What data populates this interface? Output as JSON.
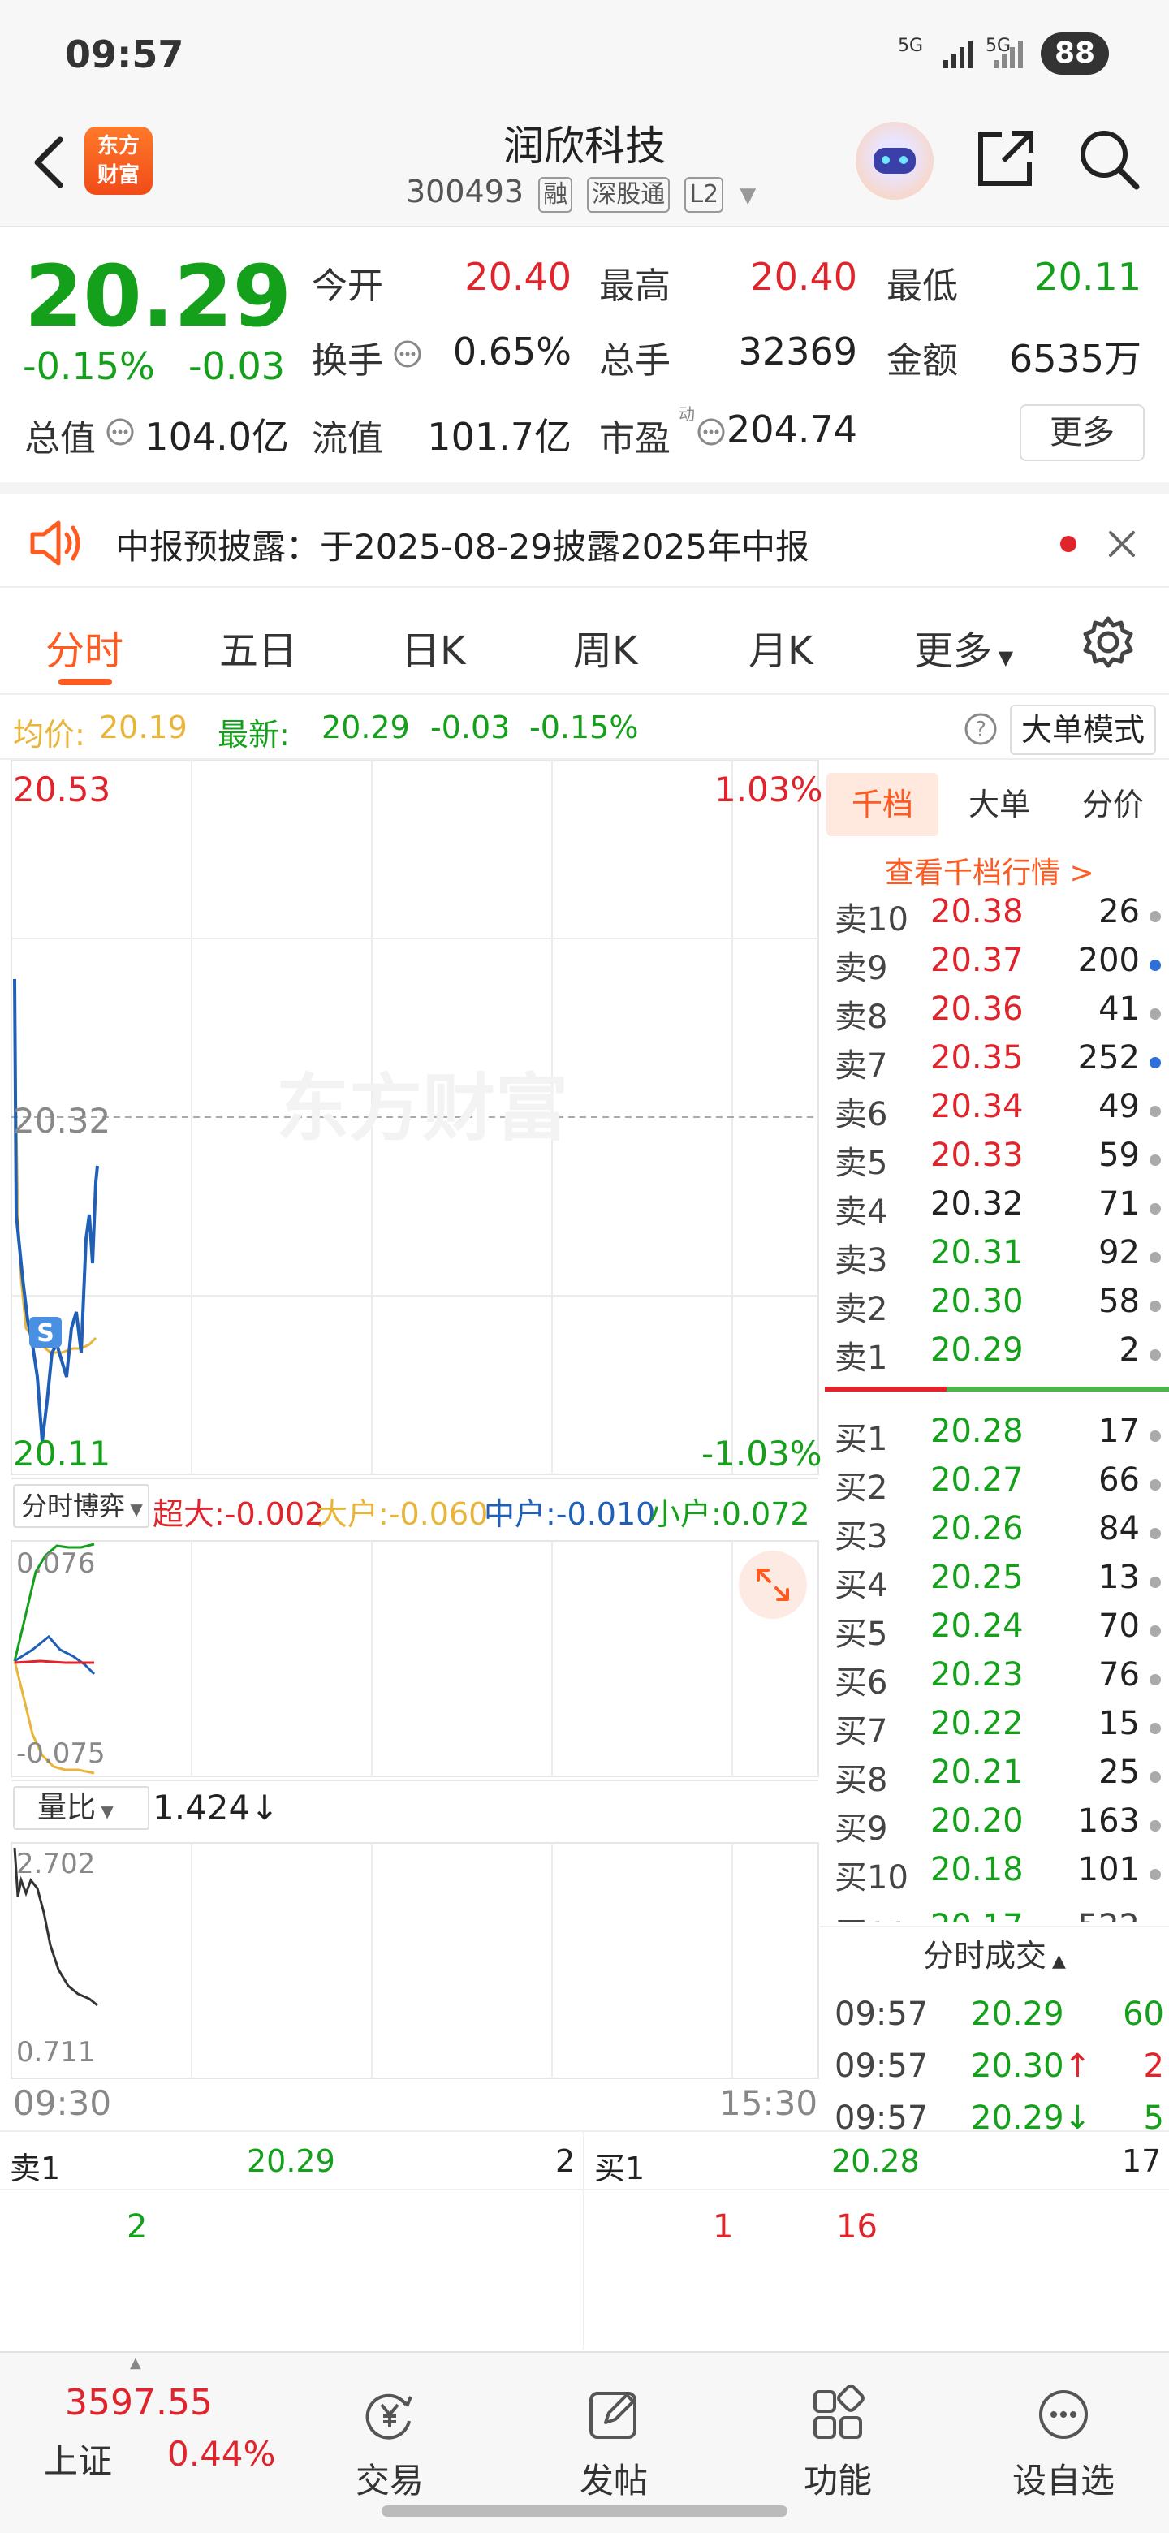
{
  "status_bar": {
    "time": "09:57",
    "signal1": "5G",
    "signal2": "5G",
    "battery": "88"
  },
  "header": {
    "logo_text": "东方财富",
    "stock_name": "润欣科技",
    "stock_code": "300493",
    "tags": [
      "融",
      "深股通",
      "L2"
    ]
  },
  "quote": {
    "price": "20.29",
    "change_pct": "-0.15%",
    "change": "-0.03",
    "open_label": "今开",
    "open": "20.40",
    "high_label": "最高",
    "high": "20.40",
    "low_label": "最低",
    "low": "20.11",
    "turnover_label": "换手",
    "turnover": "0.65%",
    "volume_label": "总手",
    "volume": "32369",
    "amount_label": "金额",
    "amount": "6535万",
    "mktcap_label": "总值",
    "mktcap": "104.0亿",
    "float_label": "流值",
    "float": "101.7亿",
    "pe_label": "市盈",
    "pe_sup": "动",
    "pe": "204.74",
    "more_label": "更多"
  },
  "notice": {
    "text": "中报预披露：于2025-08-29披露2025年中报"
  },
  "tabs": [
    "分时",
    "五日",
    "日K",
    "周K",
    "月K",
    "更多"
  ],
  "info_line": {
    "avg_label": "均价:",
    "avg": "20.19",
    "latest_label": "最新:",
    "latest": "20.29",
    "latest_chg": "-0.03",
    "latest_pct": "-0.15%",
    "mode_button": "大单模式"
  },
  "chart": {
    "y_top": "20.53",
    "y_top_pct": "1.03%",
    "y_mid": "20.32",
    "y_bottom": "20.11",
    "y_bottom_pct": "-1.03%",
    "watermark": "东方财富",
    "marker": "S",
    "flow_selector": "分时博弈",
    "flow_super": "超大:-0.002",
    "flow_large": "大户:-0.060",
    "flow_mid": "中户:-0.010",
    "flow_small": "小户:0.072",
    "flow_top": "0.076",
    "flow_bottom": "-0.075",
    "ratio_selector": "量比",
    "ratio_value": "1.424↓",
    "ratio_top": "2.702",
    "ratio_bottom": "0.711",
    "time_start": "09:30",
    "time_end": "15:30",
    "colors": {
      "price_line": "#1f5fb8",
      "avg_line": "#e8b53a",
      "red": "#e0242b",
      "green": "#14a01a"
    }
  },
  "order_book": {
    "tabs": [
      "千档",
      "大单",
      "分价"
    ],
    "link": "查看千档行情 >",
    "sells": [
      {
        "label": "卖10",
        "price": "20.38",
        "vol": "26",
        "dot": "gray"
      },
      {
        "label": "卖9",
        "price": "20.37",
        "vol": "200",
        "dot": "blue"
      },
      {
        "label": "卖8",
        "price": "20.36",
        "vol": "41",
        "dot": "gray"
      },
      {
        "label": "卖7",
        "price": "20.35",
        "vol": "252",
        "dot": "blue"
      },
      {
        "label": "卖6",
        "price": "20.34",
        "vol": "49",
        "dot": "gray"
      },
      {
        "label": "卖5",
        "price": "20.33",
        "vol": "59",
        "dot": "gray"
      },
      {
        "label": "卖4",
        "price": "20.32",
        "vol": "71",
        "dot": "gray"
      },
      {
        "label": "卖3",
        "price": "20.31",
        "vol": "92",
        "dot": "gray"
      },
      {
        "label": "卖2",
        "price": "20.30",
        "vol": "58",
        "dot": "gray"
      },
      {
        "label": "卖1",
        "price": "20.29",
        "vol": "2",
        "dot": "gray"
      }
    ],
    "buys": [
      {
        "label": "买1",
        "price": "20.28",
        "vol": "17",
        "dot": "gray"
      },
      {
        "label": "买2",
        "price": "20.27",
        "vol": "66",
        "dot": "gray"
      },
      {
        "label": "买3",
        "price": "20.26",
        "vol": "84",
        "dot": "gray"
      },
      {
        "label": "买4",
        "price": "20.25",
        "vol": "13",
        "dot": "gray"
      },
      {
        "label": "买5",
        "price": "20.24",
        "vol": "70",
        "dot": "gray"
      },
      {
        "label": "买6",
        "price": "20.23",
        "vol": "76",
        "dot": "gray"
      },
      {
        "label": "买7",
        "price": "20.22",
        "vol": "15",
        "dot": "gray"
      },
      {
        "label": "买8",
        "price": "20.21",
        "vol": "25",
        "dot": "gray"
      },
      {
        "label": "买9",
        "price": "20.20",
        "vol": "163",
        "dot": "gray"
      },
      {
        "label": "买10",
        "price": "20.18",
        "vol": "101",
        "dot": "gray"
      }
    ],
    "ticks_title": "分时成交",
    "ticks": [
      {
        "time": "09:57",
        "price": "20.29",
        "vol": "60",
        "dir": ""
      },
      {
        "time": "09:57",
        "price": "20.30↑",
        "vol": "2",
        "dir": "up"
      },
      {
        "time": "09:57",
        "price": "20.29↓",
        "vol": "5",
        "dir": "down"
      }
    ]
  },
  "queue": {
    "sell_label": "卖1",
    "sell_price": "20.29",
    "sell_vol": "2",
    "buy_label": "买1",
    "buy_price": "20.28",
    "buy_vol": "17",
    "sell_items": [
      "2"
    ],
    "buy_items": [
      "1",
      "16"
    ]
  },
  "bottom_nav": {
    "index_value": "3597.55",
    "index_name": "上证",
    "index_pct": "0.44%",
    "items": [
      "交易",
      "发帖",
      "功能",
      "设自选"
    ]
  }
}
